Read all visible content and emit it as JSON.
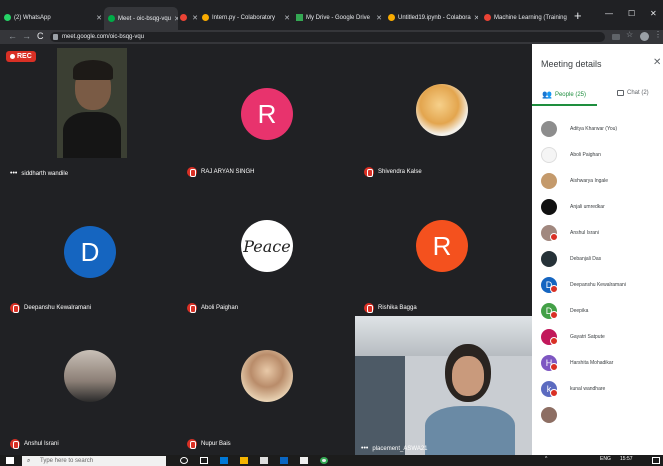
{
  "browser": {
    "tabs": [
      {
        "title": "(2) WhatsApp",
        "color": "#25d366"
      },
      {
        "title": "Meet - oic-bsqg-vqu",
        "color": "#00ac47"
      },
      {
        "title": "",
        "color": "#ea4335"
      },
      {
        "title": "Intern.py - Colaboratory",
        "color": "#f9ab00"
      },
      {
        "title": "My Drive - Google Drive",
        "color": "#34a853"
      },
      {
        "title": "Untitled19.ipynb - Colabora",
        "color": "#f9ab00"
      },
      {
        "title": "Machine Learning (Training",
        "color": "#ea4335"
      }
    ],
    "url": "meet.google.com/oic-bsqg-vqu",
    "new_tab": "+",
    "minimize": "—",
    "maximize": "☐",
    "close": "✕",
    "back": "←",
    "forward": "→",
    "reload": "C"
  },
  "meeting": {
    "rec_label": "REC",
    "tiles": [
      {
        "name": "siddharth wandile",
        "type": "video"
      },
      {
        "name": "RAJ ARYAN SINGH",
        "type": "letter",
        "letter": "R",
        "color": "#e8336d"
      },
      {
        "name": "Shivendra Kalse",
        "type": "photo"
      },
      {
        "name": "Deepanshu Kewalramani",
        "type": "letter",
        "letter": "D",
        "color": "#1565c0"
      },
      {
        "name": "Aboli Paighan",
        "type": "peace",
        "label": "Peace"
      },
      {
        "name": "Rishika Bagga",
        "type": "letter",
        "letter": "R",
        "color": "#f4511e"
      },
      {
        "name": "Anshul Israni",
        "type": "photo"
      },
      {
        "name": "Nupur Bais",
        "type": "photo"
      },
      {
        "name": "placement_ASWA21",
        "type": "video"
      }
    ]
  },
  "panel": {
    "title": "Meeting details",
    "close_icon": "✕",
    "people_tab": "People (25)",
    "chat_tab": "Chat (2)",
    "people": [
      {
        "name": "Aditya Kharwar (You)",
        "avatar_color": "#8d8d8d",
        "letter": ""
      },
      {
        "name": "Aboli Paighan",
        "avatar_color": "#f5f5f5",
        "letter": ""
      },
      {
        "name": "Aishwarya Ingale",
        "avatar_color": "#c49a6c",
        "letter": ""
      },
      {
        "name": "Anjali umredkar",
        "avatar_color": "#111111",
        "letter": ""
      },
      {
        "name": "Anshul Israni",
        "avatar_color": "#a1887f",
        "letter": ""
      },
      {
        "name": "Debanjali Das",
        "avatar_color": "#263238",
        "letter": ""
      },
      {
        "name": "Deepanshu Kewalramani",
        "avatar_color": "#1565c0",
        "letter": "D"
      },
      {
        "name": "Deepika",
        "avatar_color": "#43a047",
        "letter": "D"
      },
      {
        "name": "Gayatri Satpute",
        "avatar_color": "#c2185b",
        "letter": ""
      },
      {
        "name": "Harshita Mohadikar",
        "avatar_color": "#7e57c2",
        "letter": "H"
      },
      {
        "name": "kunal wandhare",
        "avatar_color": "#5c6bc0",
        "letter": "k"
      },
      {
        "name": "",
        "avatar_color": "#8d6e63",
        "letter": ""
      }
    ]
  },
  "taskbar": {
    "search_placeholder": "Type here to search",
    "tray_lang": "ENG",
    "tray_time": "15:57"
  }
}
